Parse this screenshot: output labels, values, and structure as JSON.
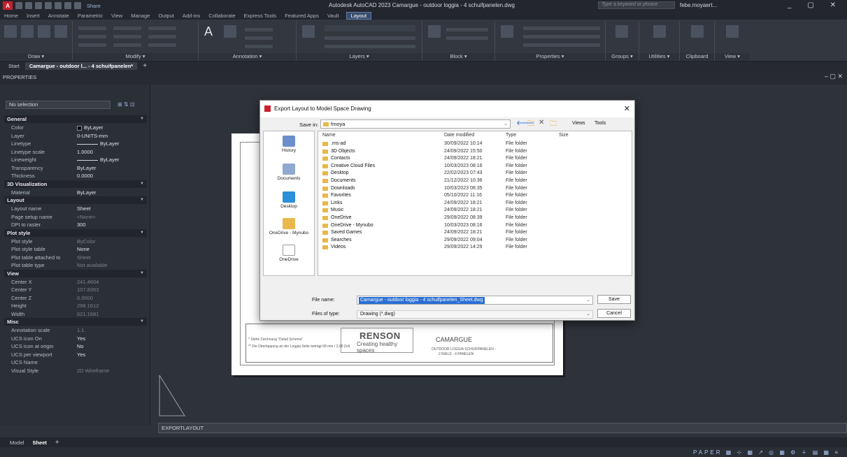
{
  "titlebar": {
    "app_title": "Autodesk AutoCAD 2023   Camargue - outdoor loggia - 4 schuifpanelen.dwg",
    "share_label": "Share",
    "search_placeholder": "Type a keyword or phrase",
    "user": "febe.moyaert...",
    "window_controls": "_ ▢ ✕"
  },
  "ribbon_tabs": [
    "Home",
    "Insert",
    "Annotate",
    "Parametric",
    "View",
    "Manage",
    "Output",
    "Add-ins",
    "Collaborate",
    "Express Tools",
    "Featured Apps",
    "Vault",
    "Layout"
  ],
  "ribbon_active_tab": "Layout",
  "ribbon_panels": [
    "Draw ▾",
    "Modify ▾",
    "Annotation ▾",
    "Layers ▾",
    "Block ▾",
    "Properties ▾",
    "Groups ▾",
    "Utilities ▾",
    "Clipboard",
    "View ▾"
  ],
  "doc_tabs": [
    "Start",
    "Camargue - outdoor l... - 4 schuifpanelen*"
  ],
  "props": {
    "title": "PROPERTIES",
    "selection": "No selection",
    "sections": [
      {
        "name": "General",
        "rows": [
          {
            "k": "Color",
            "v": "ByLayer",
            "swatch": true
          },
          {
            "k": "Layer",
            "v": "0-UNITS-mm"
          },
          {
            "k": "Linetype",
            "v": "ByLayer",
            "line": true
          },
          {
            "k": "Linetype scale",
            "v": "1.0000"
          },
          {
            "k": "Lineweight",
            "v": "ByLayer",
            "line": true
          },
          {
            "k": "Transparency",
            "v": "ByLayer"
          },
          {
            "k": "Thickness",
            "v": "0.0000"
          }
        ]
      },
      {
        "name": "3D Visualization",
        "rows": [
          {
            "k": "Material",
            "v": "ByLayer"
          }
        ]
      },
      {
        "name": "Layout",
        "rows": [
          {
            "k": "Layout name",
            "v": "Sheet"
          },
          {
            "k": "Page setup name",
            "v": "<None>",
            "dim": true
          },
          {
            "k": "DPI to raster",
            "v": "300"
          }
        ]
      },
      {
        "name": "Plot style",
        "rows": [
          {
            "k": "Plot style",
            "v": "ByColor",
            "dim": true
          },
          {
            "k": "Plot style table",
            "v": "None"
          },
          {
            "k": "Plot table attached to",
            "v": "Sheet",
            "dim": true
          },
          {
            "k": "Plot table type",
            "v": "Not available",
            "dim": true
          }
        ]
      },
      {
        "name": "View",
        "rows": [
          {
            "k": "Center X",
            "v": "241.4604",
            "dim": true
          },
          {
            "k": "Center Y",
            "v": "107.8363",
            "dim": true
          },
          {
            "k": "Center Z",
            "v": "0.0000",
            "dim": true
          },
          {
            "k": "Height",
            "v": "298.1612",
            "dim": true
          },
          {
            "k": "Width",
            "v": "621.1681",
            "dim": true
          }
        ]
      },
      {
        "name": "Misc",
        "rows": [
          {
            "k": "Annotation scale",
            "v": "1:1",
            "dim": true
          },
          {
            "k": "UCS icon On",
            "v": "Yes"
          },
          {
            "k": "UCS icon at origin",
            "v": "No"
          },
          {
            "k": "UCS per viewport",
            "v": "Yes"
          },
          {
            "k": "UCS Name",
            "v": ""
          },
          {
            "k": "Visual Style",
            "v": "2D Wireframe",
            "dim": true
          }
        ]
      }
    ]
  },
  "dialog": {
    "title": "Export Layout to Model Space Drawing",
    "save_in_label": "Save in:",
    "save_in_value": "fmoya",
    "views_label": "Views",
    "tools_label": "Tools",
    "places": [
      "History",
      "Documents",
      "Desktop",
      "OneDrive - Mynubo",
      "OneDrive"
    ],
    "columns": [
      "Name",
      "Date modified",
      "Type",
      "Size"
    ],
    "files": [
      {
        "name": ".ms-ad",
        "date": "30/09/2022 10:14",
        "type": "File folder"
      },
      {
        "name": "3D Objects",
        "date": "24/09/2022 15:50",
        "type": "File folder"
      },
      {
        "name": "Contacts",
        "date": "24/09/2022 18:21",
        "type": "File folder"
      },
      {
        "name": "Creative Cloud Files",
        "date": "10/03/2023 08:16",
        "type": "File folder"
      },
      {
        "name": "Desktop",
        "date": "22/02/2023 07:43",
        "type": "File folder"
      },
      {
        "name": "Documents",
        "date": "21/12/2022 10:36",
        "type": "File folder"
      },
      {
        "name": "Downloads",
        "date": "10/03/2023 08:35",
        "type": "File folder"
      },
      {
        "name": "Favorites",
        "date": "05/10/2022 11:16",
        "type": "File folder"
      },
      {
        "name": "Links",
        "date": "24/09/2022 18:21",
        "type": "File folder"
      },
      {
        "name": "Music",
        "date": "24/09/2022 18:21",
        "type": "File folder"
      },
      {
        "name": "OneDrive",
        "date": "29/09/2022 08:39",
        "type": "File folder"
      },
      {
        "name": "OneDrive - Mynubo",
        "date": "10/03/2023 08:16",
        "type": "File folder"
      },
      {
        "name": "Saved Games",
        "date": "24/09/2022 18:21",
        "type": "File folder"
      },
      {
        "name": "Searches",
        "date": "29/09/2022 09:04",
        "type": "File folder"
      },
      {
        "name": "Videos",
        "date": "29/09/2022 14:29",
        "type": "File folder"
      }
    ],
    "file_name_label": "File name:",
    "file_name_value": "Camargue - outdoor loggia - 4 schuifpanelen_Sheet.dwg",
    "file_type_label": "Files of type:",
    "file_type_value": "Drawing (*.dwg)",
    "save_label": "Save",
    "cancel_label": "Cancel"
  },
  "paper": {
    "brand": "RENSON",
    "brand_sub": "Creating healthy spaces",
    "project": "CAMARGUE",
    "block_line1": "OUTDOOR LOGGIA SCHUIFPANELEN -",
    "block_line2": "2 RAILS - 4 PANELEN",
    "note1": "* Siehe Zeichnung \"Detail Scheme\"",
    "note2": "** Die Überlappung an der Loggia-Seite beträgt 68 mm / 2,68 Zoll."
  },
  "command_line": "EXPORTLAYOUT",
  "layout_tabs": [
    "Model",
    "Sheet"
  ],
  "active_layout": "Sheet",
  "status_right": "PAPER ▦ ⊹ ▦ ↗ ◎ ▦ ⚙ ＋ ▤ ▦ ≡",
  "colors": {
    "ui_dark": "#2b2f36",
    "accent": "#2a6ed3",
    "autocad_red": "#c8202f"
  }
}
